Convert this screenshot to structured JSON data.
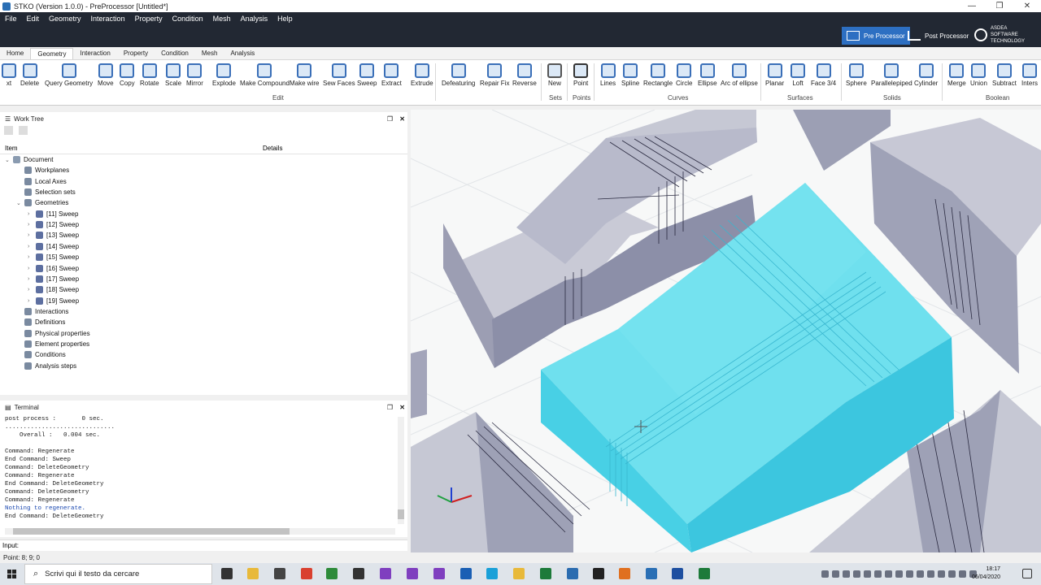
{
  "window": {
    "title": "STKO (Version 1.0.0) - PreProcessor [Untitled*]"
  },
  "menu": [
    "File",
    "Edit",
    "Geometry",
    "Interaction",
    "Property",
    "Condition",
    "Mesh",
    "Analysis",
    "Help"
  ],
  "modes": {
    "pre": "Pre Processor",
    "post": "Post Processor"
  },
  "brand": {
    "line1": "ASDEA",
    "line2": "SOFTWARE",
    "line3": "TECHNOLOGY"
  },
  "tabs": [
    "Home",
    "Geometry",
    "Interaction",
    "Property",
    "Condition",
    "Mesh",
    "Analysis"
  ],
  "ribbon": {
    "edit_buttons": [
      "xt",
      "Delete",
      "Query Geometry",
      "Move",
      "Copy",
      "Rotate",
      "Scale",
      "Mirror",
      "Explode",
      "Make Compound",
      "Make wire",
      "Sew Faces",
      "Sweep",
      "Extract",
      "Extrude",
      "Defeaturing",
      "Repair Fix",
      "Reverse"
    ],
    "edit_label": "Edit",
    "sets_buttons": [
      "New"
    ],
    "sets_label": "Sets",
    "points_buttons": [
      "Point"
    ],
    "points_label": "Points",
    "curves_buttons": [
      "Lines",
      "Spline",
      "Rectangle",
      "Circle",
      "Ellipse",
      "Arc of ellipse"
    ],
    "curves_label": "Curves",
    "surfaces_buttons": [
      "Planar",
      "Loft",
      "Face 3/4"
    ],
    "surfaces_label": "Surfaces",
    "solids_buttons": [
      "Sphere",
      "Parallelepiped",
      "Cylinder"
    ],
    "solids_label": "Solids",
    "boolean_buttons": [
      "Merge",
      "Union",
      "Subtract",
      "Inters"
    ],
    "boolean_label": "Boolean"
  },
  "worktree": {
    "title": "Work Tree",
    "col_item": "Item",
    "col_details": "Details",
    "root": "Document",
    "items": [
      "Workplanes",
      "Local Axes",
      "Selection sets",
      "Geometries"
    ],
    "sweeps": [
      "[11] Sweep",
      "[12] Sweep",
      "[13] Sweep",
      "[14] Sweep",
      "[15] Sweep",
      "[16] Sweep",
      "[17] Sweep",
      "[18] Sweep",
      "[19] Sweep"
    ],
    "items_after": [
      "Interactions",
      "Definitions",
      "Physical properties",
      "Element properties",
      "Conditions",
      "Analysis steps"
    ]
  },
  "terminal": {
    "title": "Terminal",
    "lines": [
      "post process :       0 sec.",
      "..............................",
      "    Overall :   0.004 sec.",
      "",
      "Command: Regenerate",
      "End Command: Sweep",
      "Command: DeleteGeometry",
      "Command: Regenerate",
      "End Command: DeleteGeometry",
      "Command: DeleteGeometry",
      "Command: Regenerate",
      "Nothing to regenerate.",
      "End Command: DeleteGeometry"
    ],
    "input_label": "Input:"
  },
  "status": {
    "text": "Point: 8; 9; 0"
  },
  "taskbar": {
    "search_placeholder": "Scrivi qui il testo da cercare",
    "time": "18:17",
    "date": "06/04/2020"
  },
  "colors": {
    "accent": "#2d6fc2",
    "selected_solid": "#4fd8ea",
    "solid_gray": "#b9bccc",
    "dark_bar": "#222833"
  }
}
